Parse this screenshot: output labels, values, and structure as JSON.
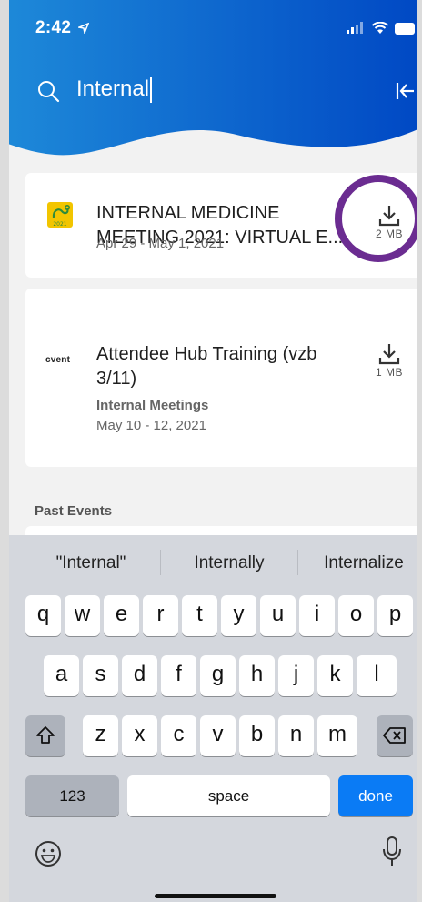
{
  "colors": {
    "header_gradient_start": "#1e88d8",
    "header_gradient_end": "#0050c8",
    "accent": "#0a7bf5",
    "highlight": "#6b2c91"
  },
  "status": {
    "time": "2:42",
    "location_icon": "location-arrow-icon",
    "signal_icon": "signal-icon",
    "wifi_icon": "wifi-icon",
    "battery_icon": "battery-icon"
  },
  "search": {
    "value": "Internal",
    "search_icon": "search-icon",
    "collapse_icon": "collapse-left-icon"
  },
  "results": [
    {
      "title": "INTERNAL MEDICINE MEETING 2021: VIRTUAL E...",
      "dates": "Apr 29 - May 1, 2021",
      "subtitle": "",
      "download_size": "2 MB",
      "logo_text": "2021"
    },
    {
      "title": "Attendee Hub Training (vzb 3/11)",
      "dates": "May 10 - 12, 2021",
      "subtitle": "Internal Meetings",
      "download_size": "1 MB",
      "logo_text": "cvent"
    }
  ],
  "past_events_label": "Past Events",
  "keyboard": {
    "suggestions": [
      "\"Internal\"",
      "Internally",
      "Internalize"
    ],
    "row1": [
      "q",
      "w",
      "e",
      "r",
      "t",
      "y",
      "u",
      "i",
      "o",
      "p"
    ],
    "row2": [
      "a",
      "s",
      "d",
      "f",
      "g",
      "h",
      "j",
      "k",
      "l"
    ],
    "row3": [
      "z",
      "x",
      "c",
      "v",
      "b",
      "n",
      "m"
    ],
    "numbers_key": "123",
    "space_key": "space",
    "done_key": "done"
  }
}
